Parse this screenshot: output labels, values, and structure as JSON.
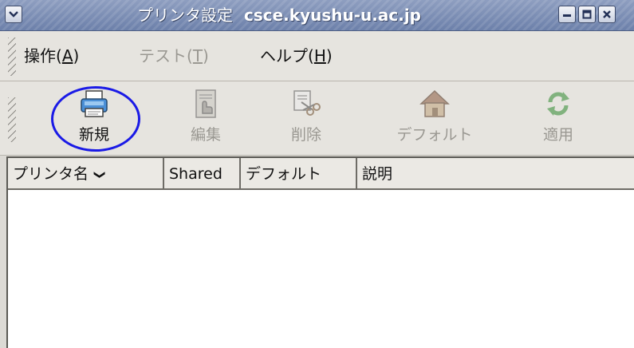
{
  "window": {
    "title": "プリンタ設定",
    "host": "csce.kyushu-u.ac.jp"
  },
  "menubar": {
    "items": [
      {
        "label": "操作(",
        "mnemonic": "A",
        "suffix": ")",
        "enabled": true
      },
      {
        "label": "テスト(",
        "mnemonic": "T",
        "suffix": ")",
        "enabled": false
      },
      {
        "label": "ヘルプ(",
        "mnemonic": "H",
        "suffix": ")",
        "enabled": true
      }
    ]
  },
  "toolbar": {
    "new_label": "新規",
    "edit_label": "編集",
    "delete_label": "削除",
    "default_label": "デフォルト",
    "apply_label": "適用"
  },
  "icons": {
    "new": "printer-icon",
    "edit": "edit-hand-icon",
    "delete": "delete-scissors-icon",
    "default": "home-icon",
    "apply": "apply-arrows-icon"
  },
  "printer_list": {
    "columns": [
      "プリンタ名",
      "Shared",
      "デフォルト",
      "説明"
    ],
    "rows": []
  },
  "colors": {
    "highlight": "#1a1ae6"
  }
}
